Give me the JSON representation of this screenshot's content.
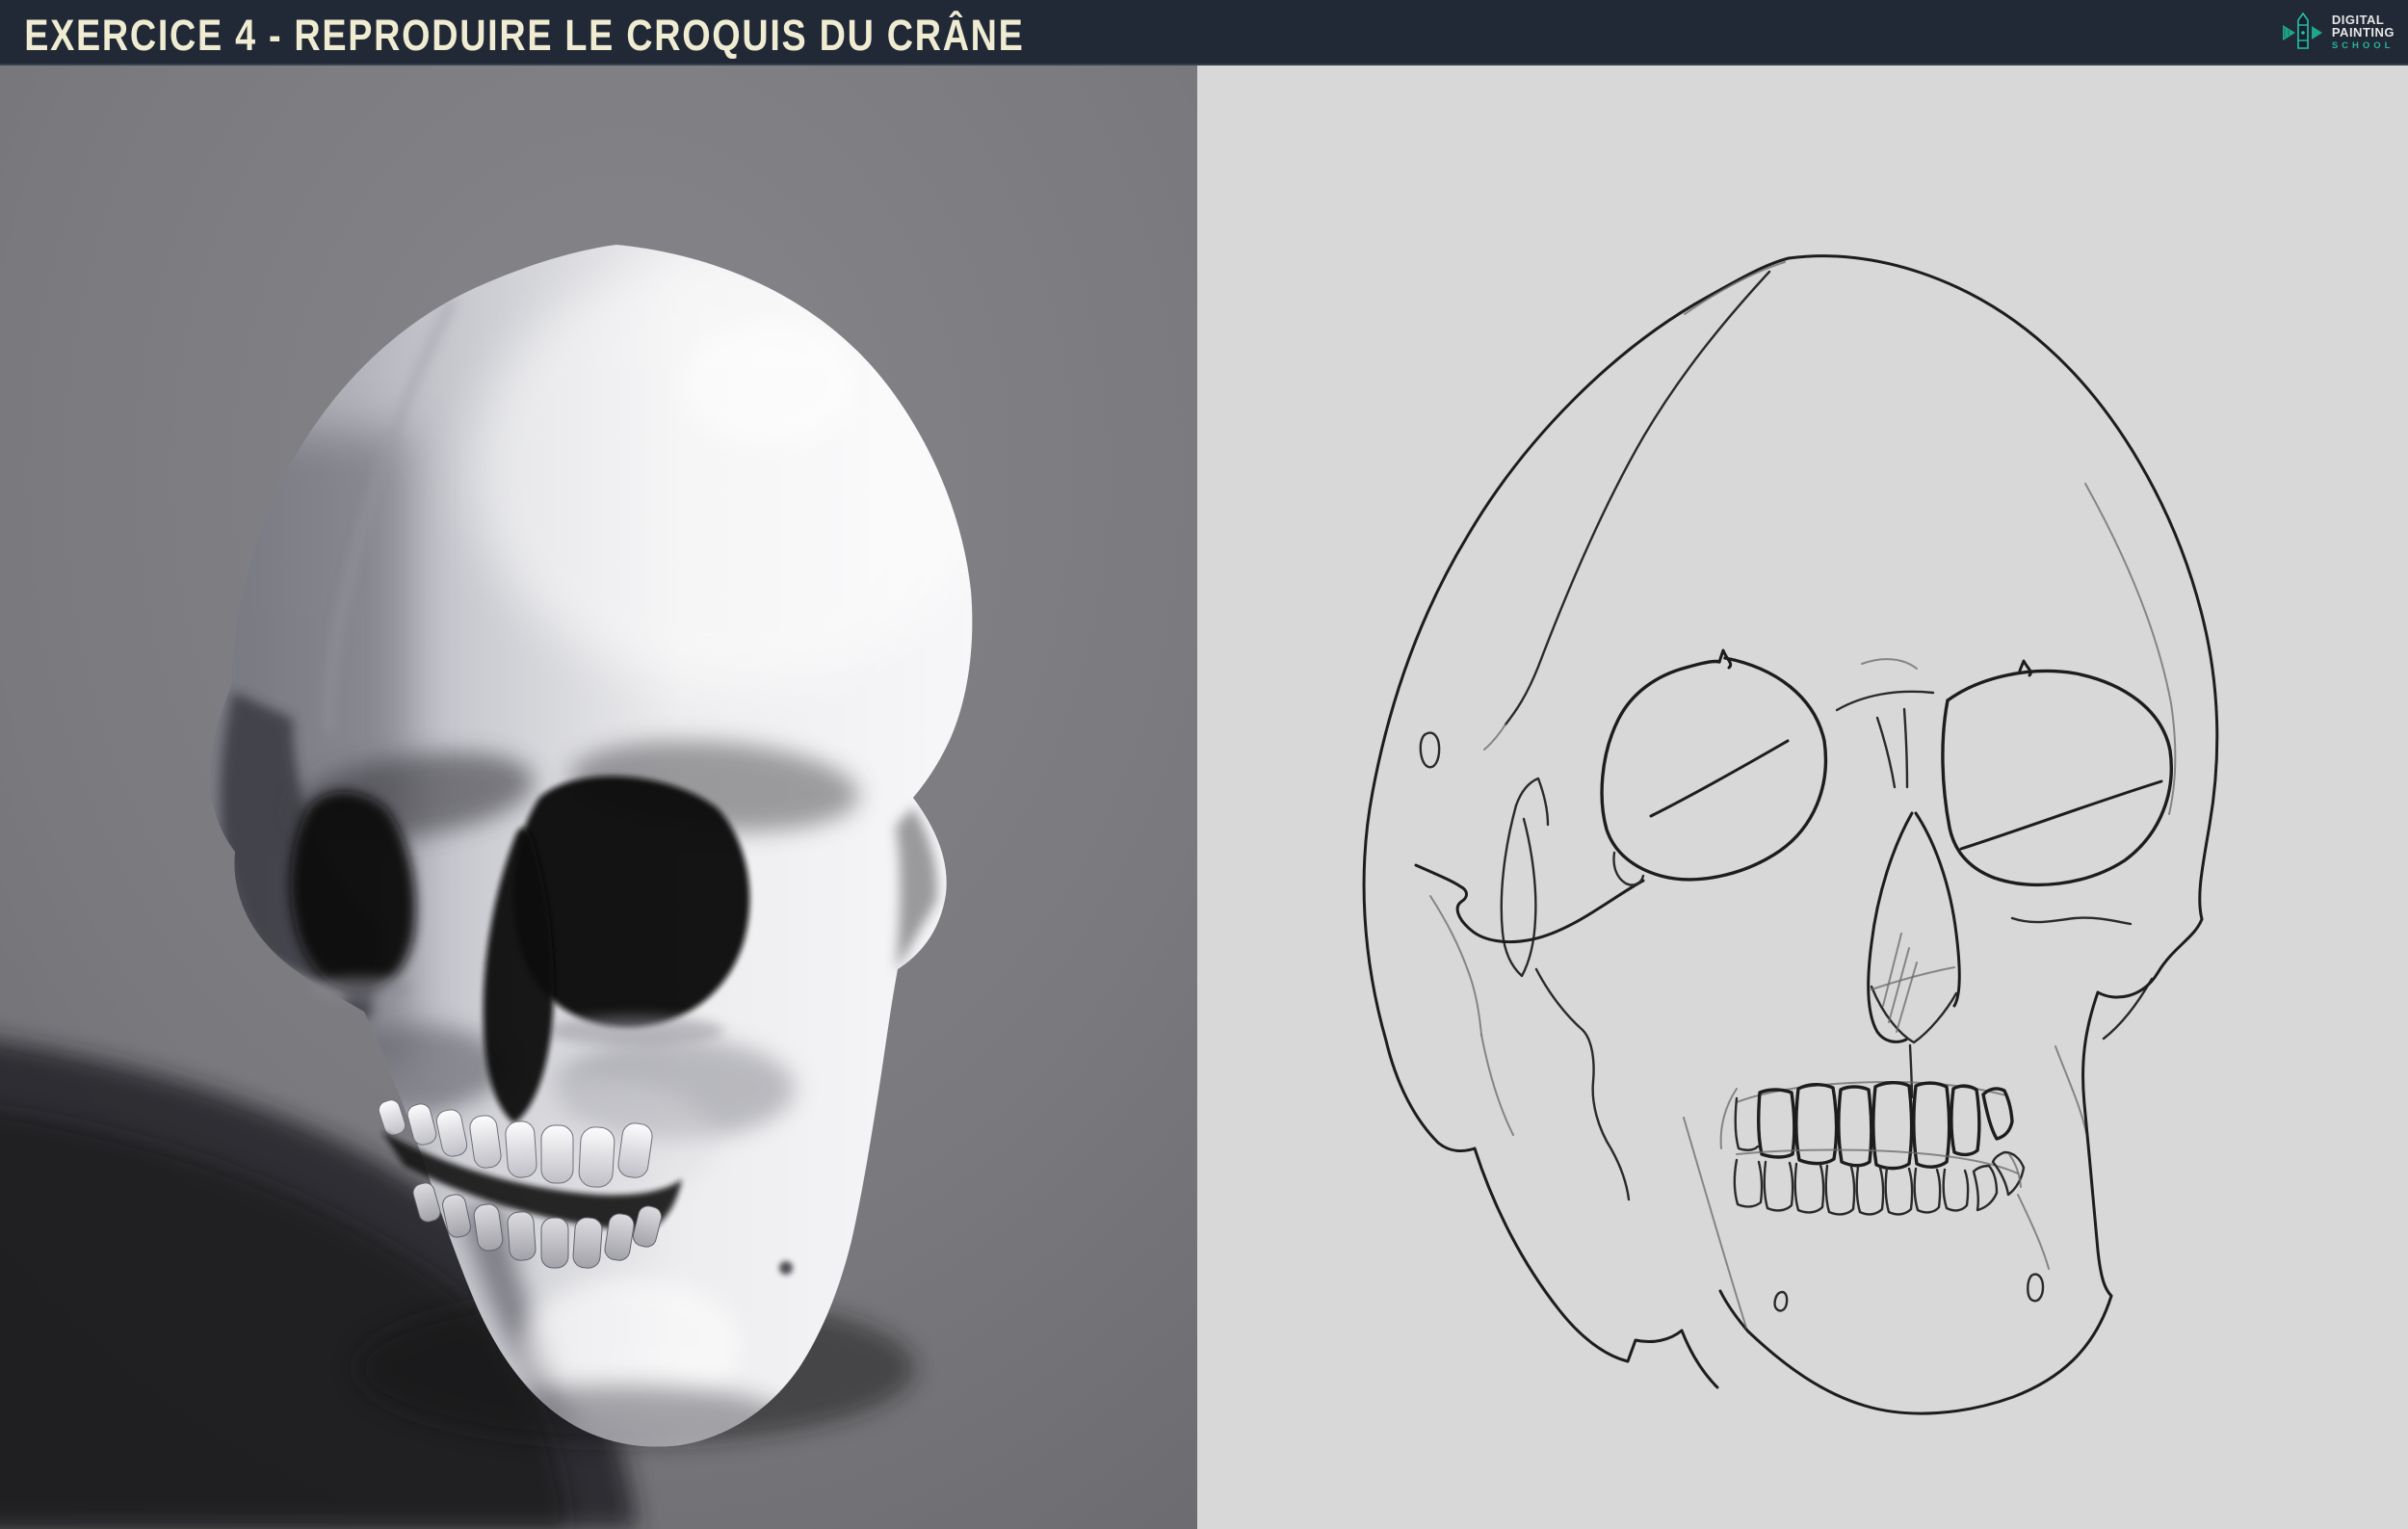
{
  "header": {
    "title": "EXERCICE 4 - REPRODUIRE LE CROQUIS DU CRÂNE"
  },
  "logo": {
    "line1": "DIGITAL",
    "line2": "PAINTING",
    "line3": "SCHOOL",
    "icon": "pencil-logo-icon"
  },
  "panels": {
    "left": {
      "content": "3D rendered human skull, three-quarter view, with cast shadow"
    },
    "right": {
      "content": "Freehand line sketch (croquis) of the same skull"
    }
  },
  "colors": {
    "header_background": "#212836",
    "header_text": "#efecd2",
    "logo_accent": "#26b79a",
    "logo_text_color": "#e6e6e6",
    "photo_panel_background": "#77777a",
    "sketch_panel_background": "#d8d8d8",
    "sketch_line_color": "#1d1d1d"
  }
}
